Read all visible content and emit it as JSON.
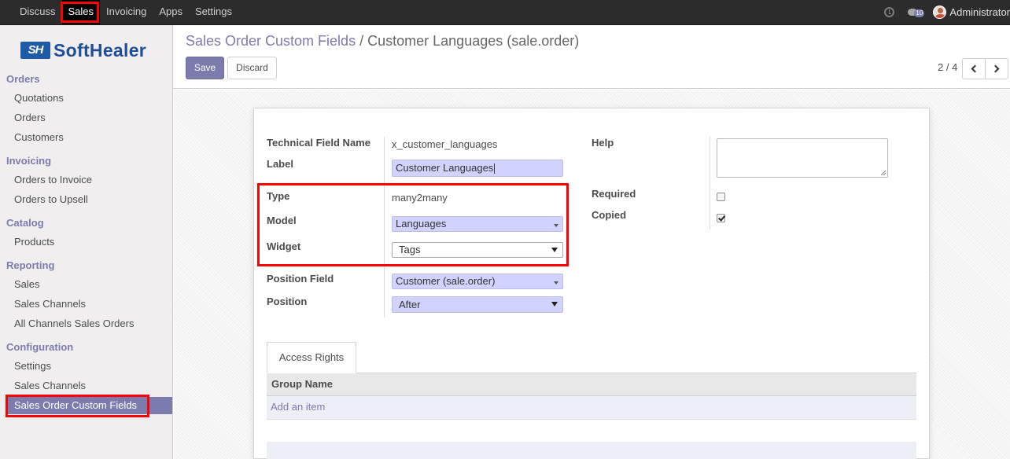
{
  "topbar": {
    "menu": [
      "Discuss",
      "Sales",
      "Invoicing",
      "Apps",
      "Settings"
    ],
    "active": "Sales",
    "notification_count": "10",
    "user": "Administrator"
  },
  "logo": {
    "mark": "SH",
    "word": "SoftHealer"
  },
  "sidebar": {
    "sections": [
      {
        "title": "Orders",
        "items": [
          "Quotations",
          "Orders",
          "Customers"
        ]
      },
      {
        "title": "Invoicing",
        "items": [
          "Orders to Invoice",
          "Orders to Upsell"
        ]
      },
      {
        "title": "Catalog",
        "items": [
          "Products"
        ]
      },
      {
        "title": "Reporting",
        "items": [
          "Sales",
          "Sales Channels",
          "All Channels Sales Orders"
        ]
      },
      {
        "title": "Configuration",
        "items": [
          "Settings",
          "Sales Channels",
          "Sales Order Custom Fields"
        ]
      }
    ],
    "active_item": "Sales Order Custom Fields"
  },
  "breadcrumb": {
    "parent": "Sales Order Custom Fields",
    "separator": "/",
    "current": "Customer Languages (sale.order)"
  },
  "buttons": {
    "save": "Save",
    "discard": "Discard"
  },
  "pager": {
    "value": "2 / 4"
  },
  "form": {
    "technical_field_name": {
      "label": "Technical Field Name",
      "value": "x_customer_languages"
    },
    "label": {
      "label": "Label",
      "value": "Customer Languages"
    },
    "type": {
      "label": "Type",
      "value": "many2many"
    },
    "model": {
      "label": "Model",
      "value": "Languages"
    },
    "widget": {
      "label": "Widget",
      "value": "Tags"
    },
    "position_field": {
      "label": "Position Field",
      "value": "Customer (sale.order)"
    },
    "position": {
      "label": "Position",
      "value": "After"
    },
    "help": {
      "label": "Help",
      "value": ""
    },
    "required": {
      "label": "Required",
      "checked": false
    },
    "copied": {
      "label": "Copied",
      "checked": true
    }
  },
  "tabs": {
    "access_rights": "Access Rights"
  },
  "table": {
    "header": "Group Name",
    "add_item": "Add an item"
  },
  "colors": {
    "accent": "#7c7bad",
    "highlight": "#ff0000",
    "topbar": "#2c2c2c",
    "required_field": "#d2d2ff"
  }
}
